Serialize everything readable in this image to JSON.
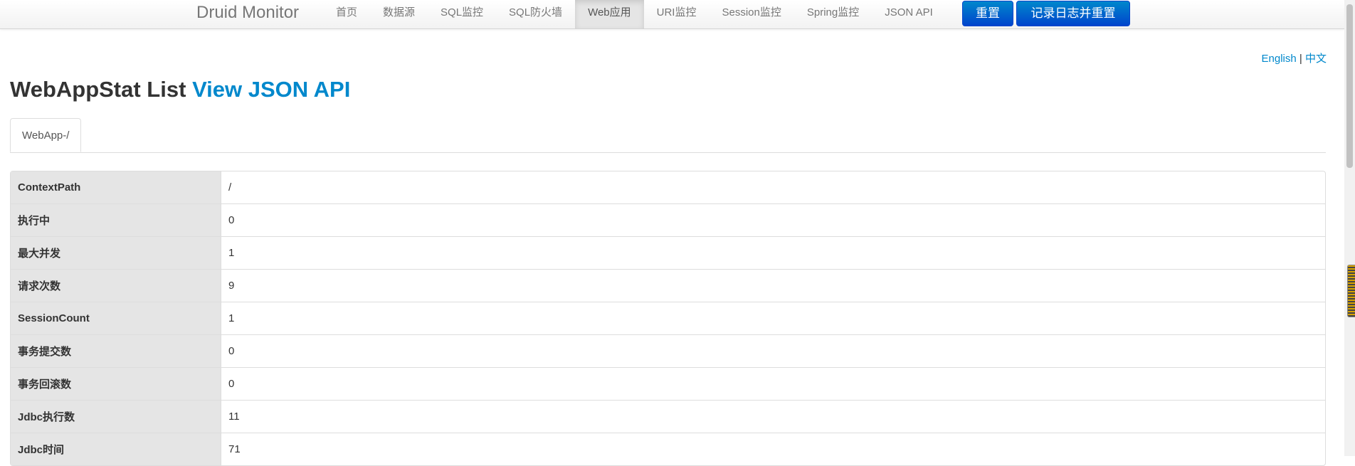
{
  "navbar": {
    "brand": "Druid Monitor",
    "items": [
      {
        "label": "首页"
      },
      {
        "label": "数据源"
      },
      {
        "label": "SQL监控"
      },
      {
        "label": "SQL防火墙"
      },
      {
        "label": "Web应用",
        "active": true
      },
      {
        "label": "URI监控"
      },
      {
        "label": "Session监控"
      },
      {
        "label": "Spring监控"
      },
      {
        "label": "JSON API"
      }
    ],
    "reset_label": "重置",
    "log_reset_label": "记录日志并重置",
    "button_color": "#0088cc"
  },
  "lang": {
    "english": "English",
    "separator": "|",
    "chinese": "中文"
  },
  "page": {
    "title": "WebAppStat List",
    "json_link": "View JSON API",
    "link_color": "#0088cc"
  },
  "tabs": [
    {
      "label": "WebApp-/"
    }
  ],
  "stats": [
    {
      "label": "ContextPath",
      "value": "/"
    },
    {
      "label": "执行中",
      "value": "0"
    },
    {
      "label": "最大并发",
      "value": "1"
    },
    {
      "label": "请求次数",
      "value": "9"
    },
    {
      "label": "SessionCount",
      "value": "1"
    },
    {
      "label": "事务提交数",
      "value": "0"
    },
    {
      "label": "事务回滚数",
      "value": "0"
    },
    {
      "label": "Jdbc执行数",
      "value": "11"
    },
    {
      "label": "Jdbc时间",
      "value": "71"
    }
  ]
}
